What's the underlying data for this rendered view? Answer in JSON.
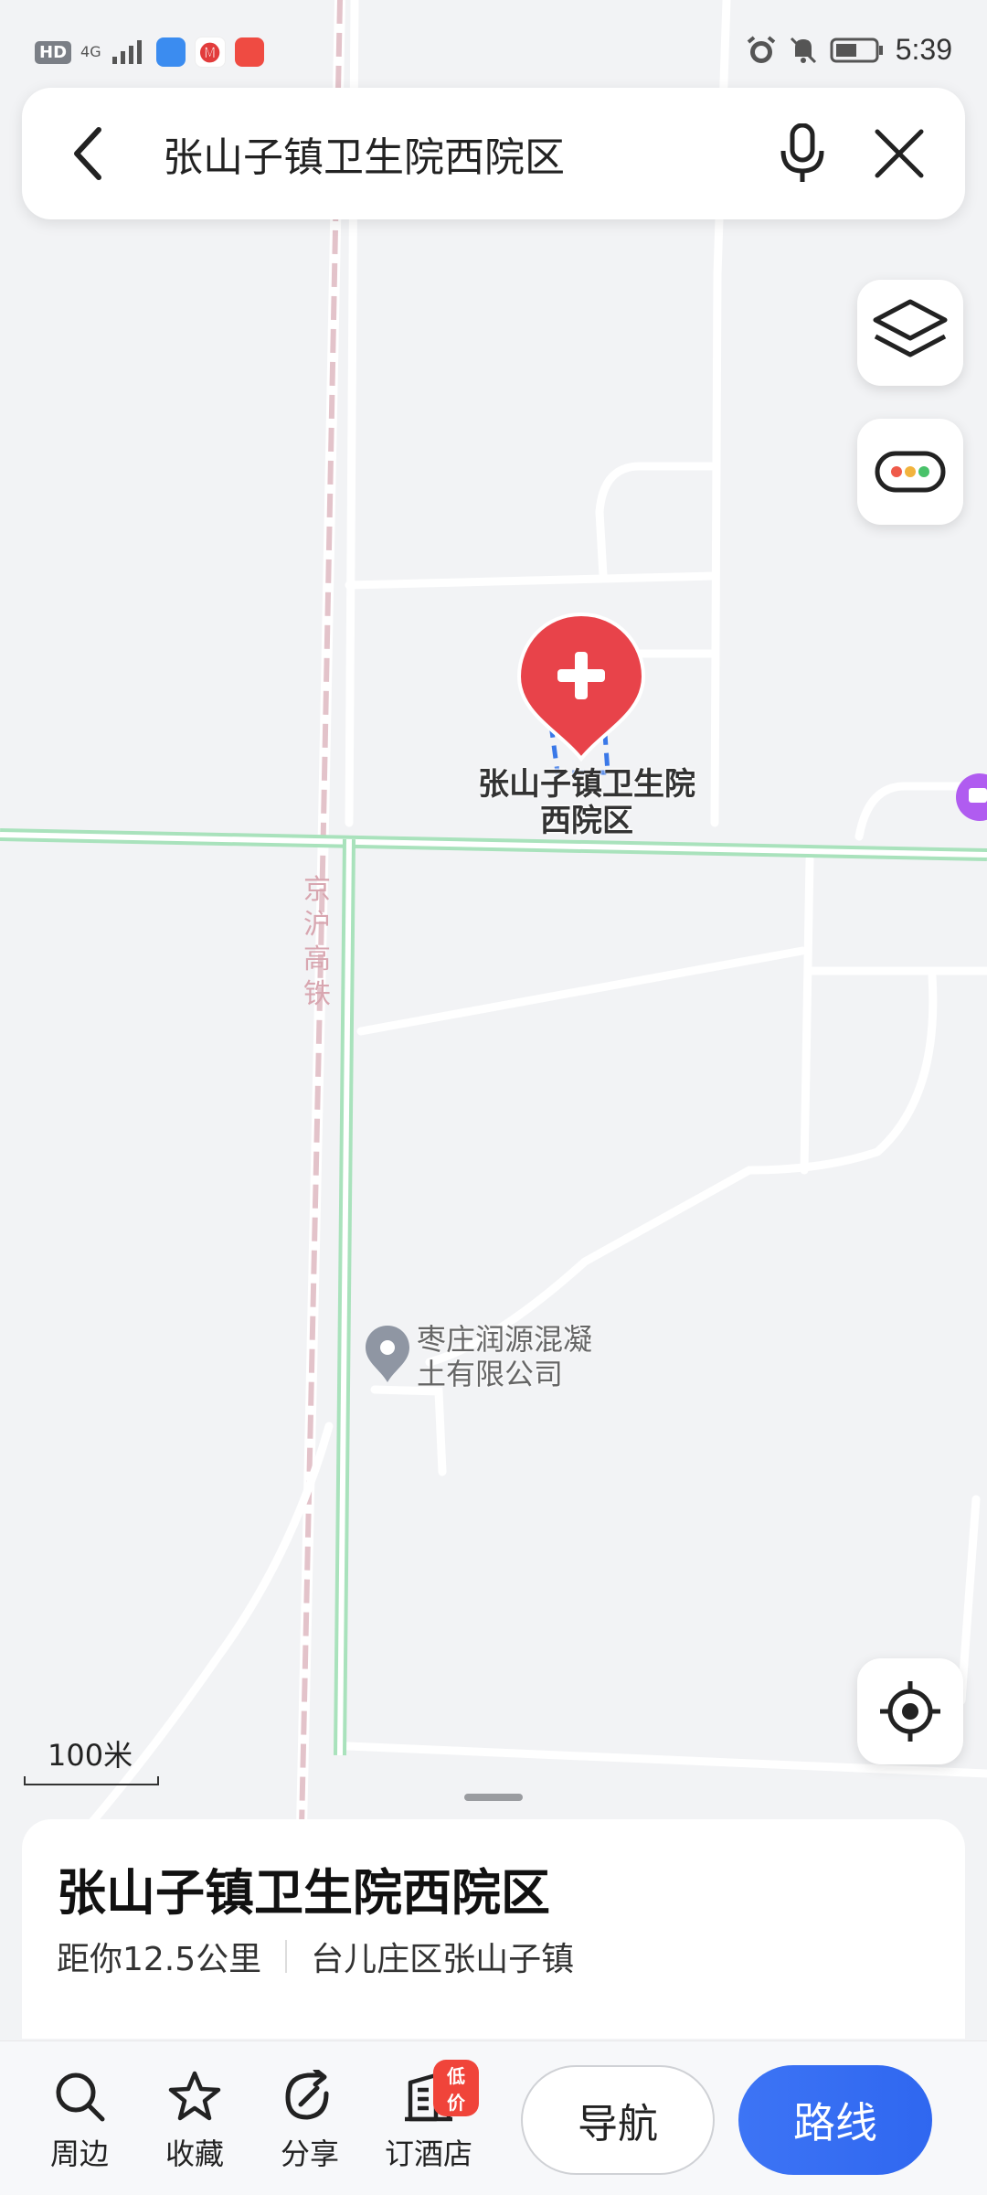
{
  "status_bar": {
    "hd": "HD",
    "network": "4G",
    "time": "5:39"
  },
  "search": {
    "query": "张山子镇卫生院西院区",
    "back_icon": "chevron-left-icon",
    "voice_icon": "microphone-icon",
    "clear_icon": "close-icon"
  },
  "map": {
    "poi_main_line1": "张山子镇卫生院",
    "poi_main_line2": "西院区",
    "poi_secondary_line1": "枣庄润源混凝",
    "poi_secondary_line2": "土有限公司",
    "rail_label": [
      "京",
      "沪",
      "高",
      "铁"
    ],
    "scale": "100米",
    "colors": {
      "background": "#f2f3f5",
      "road_green": "#a9e2bc",
      "hospital_pin": "#e8434a",
      "rail": "#e3c3ca"
    }
  },
  "place": {
    "title": "张山子镇卫生院西院区",
    "distance": "距你12.5公里",
    "area": "台儿庄区张山子镇"
  },
  "actions": {
    "nearby": "周边",
    "favorite": "收藏",
    "share": "分享",
    "hotel": "订酒店",
    "hotel_badge": "低价",
    "navigate": "导航",
    "route": "路线"
  },
  "accent": "#3570f3"
}
